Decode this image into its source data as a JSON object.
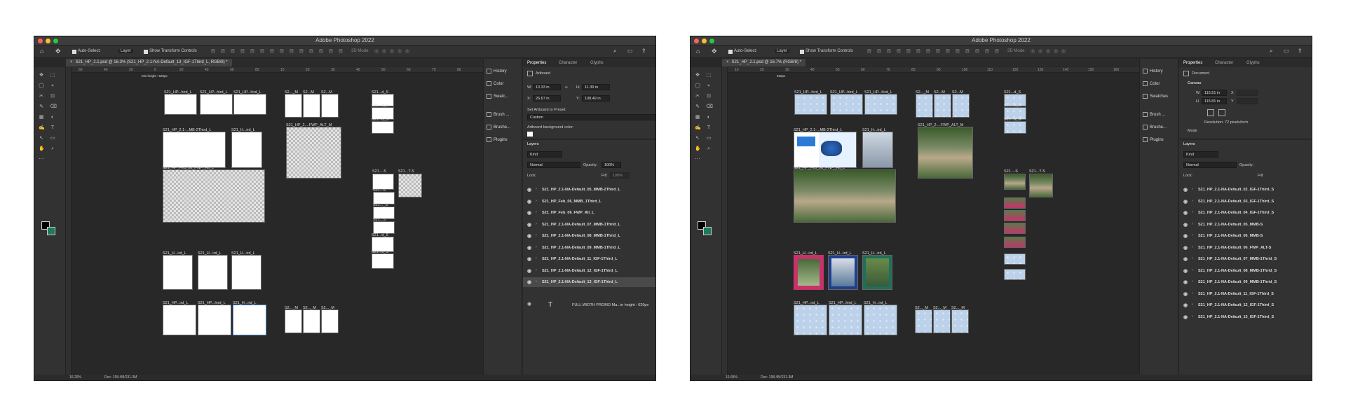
{
  "windows": [
    {
      "title": "Adobe Photoshop 2022",
      "doc_tab": "S21_HP_2.1.psd @ 16.3% (S21_HP_2.1-NA-Default_13_IGF-1Third_L, RGB/8) *",
      "options": {
        "auto_select": "Auto-Select:",
        "layer_select": "Layer",
        "transform": "Show Transform Controls",
        "mode3d": "3D Mode:"
      },
      "ruler": [
        "60",
        "40",
        "20",
        "0",
        "20",
        "40",
        "60",
        "80",
        "10",
        "20",
        "30",
        "40",
        "50",
        "60",
        "70",
        "80"
      ],
      "artboards": [
        {
          "label": "S21_HP...hird_L",
          "style": "white"
        },
        {
          "label": "S21_HP...hird_L",
          "style": "white"
        },
        {
          "label": "S21_HP...hird_L",
          "style": "white"
        },
        {
          "label": "S2..._M",
          "style": "white"
        },
        {
          "label": "S2...M",
          "style": "white"
        },
        {
          "label": "S2...M",
          "style": "white"
        },
        {
          "label": "S21...d_S",
          "style": "white"
        },
        {
          "label": "S21...d_S",
          "style": "white"
        },
        {
          "label": "S21...d_S",
          "style": "white"
        },
        {
          "label": "S21_HP_2.1-...MB-2Third_L",
          "style": "white"
        },
        {
          "label": "S21_H...ird_L",
          "style": "white"
        },
        {
          "label": "S21_HP_2....FWP_ALT_M",
          "style": "trans"
        },
        {
          "label": "S21...-S",
          "style": "white"
        },
        {
          "label": "S21...T-S",
          "style": "trans"
        },
        {
          "label": "S21...S",
          "style": "white"
        },
        {
          "label": "S21..._S",
          "style": "white"
        },
        {
          "label": "S21...S",
          "style": "white"
        },
        {
          "label": "S21...d_S",
          "style": "white"
        },
        {
          "label": "S21...d_S",
          "style": "white"
        },
        {
          "label": "S21_HP_Feb_06_FWP_Alt_L",
          "style": "trans"
        },
        {
          "label": "S21_H...ird_L",
          "style": "white"
        },
        {
          "label": "S21_H...ird_L",
          "style": "white"
        },
        {
          "label": "S21_H...ird_L",
          "style": "white"
        },
        {
          "label": "S21_HP...ird_L",
          "style": "white"
        },
        {
          "label": "S21_HP...hird_L",
          "style": "white"
        },
        {
          "label": "S21_H...ird_L",
          "style": "sel"
        },
        {
          "label": "S2..._M",
          "style": "white"
        },
        {
          "label": "S2..._M",
          "style": "white"
        },
        {
          "label": "S2..._M",
          "style": "white"
        }
      ],
      "canvas_note": "Min height : 620px",
      "mini_panel": [
        "History",
        "Color",
        "Swatc...",
        "Brush ...",
        "Brushe...",
        "Plugins"
      ],
      "props_tabs": [
        "Properties",
        "Character",
        "Glyphs"
      ],
      "props": {
        "type": "Artboard",
        "w_label": "W:",
        "w": "13.33 in",
        "h_label": "H:",
        "h": "11.39 in",
        "x_label": "X:",
        "x": "26.67 in",
        "y_label": "Y:",
        "y": "108.49 in",
        "preset_label": "Set Artboard to Preset:",
        "preset_value": "Custom",
        "bg_label": "Artboard background color:"
      },
      "layers_title": "Layers",
      "layers_kind": "Kind",
      "layers_mode": "Normal",
      "layers_opacity_label": "Opacity:",
      "layers_opacity": "100%",
      "layers_lock": "Lock:",
      "layers_fill_label": "Fill:",
      "layers_fill": "100%",
      "layers": [
        "S21_HP_2.1-NA-Default_05_MMB-2Third_L",
        "S21_HP_Feb_06_MMB_1Third_L",
        "S21_HP_Feb_06_FWP_Alt_L",
        "S21_HP_2.1-NA-Default_07_MMB-1Thrid_L",
        "S21_HP_2.1-NA-Default_08_MMB-1Thrid_L",
        "S21_HP_2.1-NA-Default_09_MMB-1Thrid_L",
        "S21_HP_2.1-NA-Default_11_IGF-1Third_L",
        "S21_HP_2.1-NA-Default_12_IGF-1Third_L",
        "S21_HP_2.1-NA-Default_13_IGF-1Third_L"
      ],
      "text_layer": "FULL WIDTH PROMO  Ma...in height :  620px",
      "zoom": "16.29%",
      "doc_size": "Doc: 198.4M/231.3M"
    },
    {
      "title": "Adobe Photoshop 2022",
      "doc_tab": "S21_HP_2.1.psd @ 16.7% (RGB/8) *",
      "options": {
        "auto_select": "Auto-Select:",
        "layer_select": "Layer",
        "transform": "Show Transform Controls",
        "mode3d": "3D Mode:"
      },
      "ruler": [
        "10",
        "20",
        "30",
        "40",
        "50",
        "60",
        "70",
        "80",
        "90",
        "100",
        "110",
        "120",
        "130",
        "140",
        "150",
        "160"
      ],
      "artboards": [
        {
          "label": "S21_HP...hird_L",
          "style": "blue"
        },
        {
          "label": "S21_HP...hird_L",
          "style": "blue"
        },
        {
          "label": "S21_HP...hird_L",
          "style": "blue"
        },
        {
          "label": "S2..._M",
          "style": "blue"
        },
        {
          "label": "S2...M",
          "style": "blue"
        },
        {
          "label": "S2...M",
          "style": "blue"
        },
        {
          "label": "S21...d_S",
          "style": "blue"
        },
        {
          "label": "S21...d_S",
          "style": "blue"
        },
        {
          "label": "S21...d_S",
          "style": "blue"
        },
        {
          "label": "S21_HP_2.1-...MB-2Third_L",
          "style": "promo"
        },
        {
          "label": "S21_H...ird_L",
          "style": "runners"
        },
        {
          "label": "S21_HP_2....FWP_ALT_M",
          "style": "bridge"
        },
        {
          "label": "S21...-S",
          "style": "bridge"
        },
        {
          "label": "S21...T-S",
          "style": "bridge"
        },
        {
          "label": "S21_HP_Feb_06_FWP_Alt_L",
          "style": "bridge"
        },
        {
          "label": "S21_H...ird_L",
          "style": "pinkcard"
        },
        {
          "label": "S21_H...ird_L",
          "style": "bluecard"
        },
        {
          "label": "S21_H...ird_L",
          "style": "tealcard"
        },
        {
          "label": "S21_HP...ird_L",
          "style": "blue"
        },
        {
          "label": "S21_HP...hird_L",
          "style": "blue"
        },
        {
          "label": "S21_H...ird_L",
          "style": "blue"
        },
        {
          "label": "S2..._M",
          "style": "blue"
        },
        {
          "label": "S2..._M",
          "style": "blue"
        },
        {
          "label": "S2..._M",
          "style": "blue"
        }
      ],
      "canvas_note": "620px",
      "mini_panel": [
        "History",
        "Color",
        "Swatches",
        "Brush ...",
        "Brushe...",
        "Plugins"
      ],
      "props_tabs": [
        "Properties",
        "Character",
        "Glyphs"
      ],
      "props": {
        "type": "Document",
        "section": "Canvas",
        "w_label": "W",
        "w": "115.51 in",
        "h_label": "H",
        "h": "115.81 in",
        "x_label": "X",
        "y_label": "Y",
        "resolution": "Resolution: 72 pixels/inch",
        "mode": "Mode"
      },
      "layers_title": "Layers",
      "layers_kind": "Kind",
      "layers_mode": "Normal",
      "layers_opacity_label": "Opacity:",
      "layers_lock": "Lock:",
      "layers_fill_label": "Fill:",
      "layers": [
        "S21_HP_2.1-NA-Default_02_IGF-1Third_S",
        "S21_HP_2.1-NA-Default_03_IGF-1Third_S",
        "S21_HP_2.1-NA-Default_04_IGF-1Third_S",
        "S21_HP_2.1-NA-Default_05_MMB-S",
        "S21_HP_2.1-NA-Default_06_MMB-S",
        "S21_HP_2.1-NA-Default_06_FWP_ALT-S",
        "S21_HP_2.1-NA-Default_07_MMB-1Thrid_S",
        "S21_HP_2.1-NA-Default_08_MMB-1Thrid_S",
        "S21_HP_2.1-NA-Default_09_MMB-1Thrid_S",
        "S21_HP_2.1-NA-Default_11_IGF-1Third_S",
        "S21_HP_2.1-NA-Default_12_IGF-1Third_S",
        "S21_HP_2.1-NA-Default_13_IGF-1Third_S"
      ],
      "zoom": "16.68%",
      "doc_size": "Doc: 198.4M/231.3M"
    }
  ],
  "colors": {
    "light_red": "#fe5f57",
    "light_yellow": "#febc2e",
    "light_green": "#28c840",
    "accent": "#4a90e2",
    "fg": "#000000",
    "bg": "#1e7a5a"
  }
}
